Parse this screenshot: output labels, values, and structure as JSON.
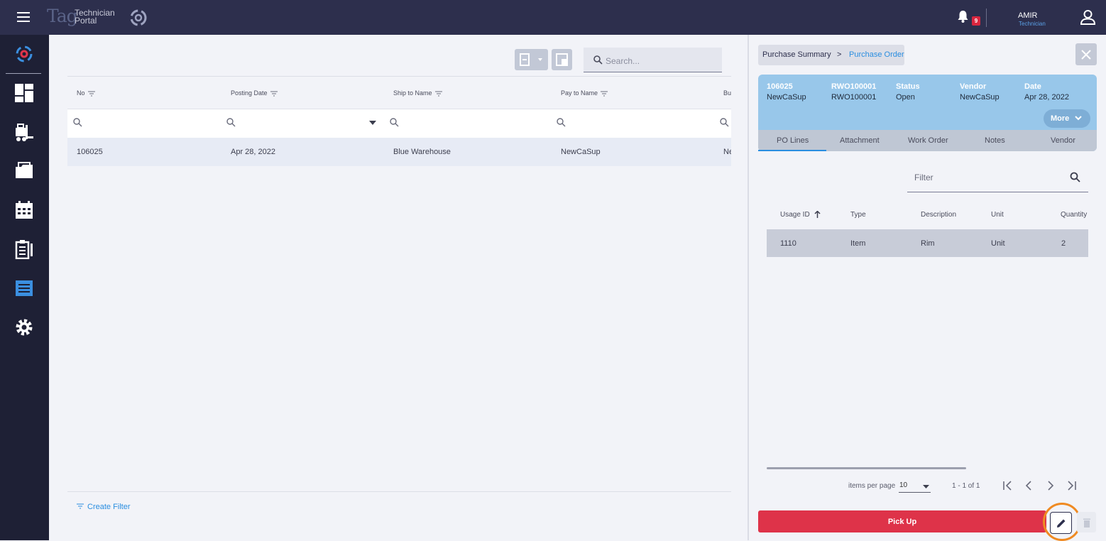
{
  "topbar": {
    "logo_tag": "Tag",
    "logo_line1": "Technician",
    "logo_line2": "Portal",
    "notification_count": "9",
    "user_name": "AMIR",
    "user_role": "Technician"
  },
  "sidebar": {
    "items": [
      {
        "icon": "spinner-logo-icon"
      },
      {
        "icon": "dashboard-icon"
      },
      {
        "icon": "forklift-icon"
      },
      {
        "icon": "folder-icon"
      },
      {
        "icon": "calendar-icon"
      },
      {
        "icon": "checklist-icon"
      },
      {
        "icon": "notebook-icon"
      },
      {
        "icon": "gear-icon"
      }
    ]
  },
  "main": {
    "search_placeholder": "Search...",
    "columns": [
      "No",
      "Posting Date",
      "Ship to Name",
      "Pay to Name",
      "Bu"
    ],
    "rows": [
      {
        "no": "106025",
        "posting_date": "Apr 28, 2022",
        "ship_to": "Blue Warehouse",
        "pay_to": "NewCaSup",
        "bu": "Ne"
      }
    ],
    "create_filter": "Create Filter"
  },
  "panel": {
    "breadcrumb": {
      "parent": "Purchase Summary",
      "separator": ">",
      "current": "Purchase Order"
    },
    "header": {
      "fields": [
        {
          "title": "106025",
          "value": "NewCaSup"
        },
        {
          "title": "RWO100001",
          "value": "RWO100001"
        },
        {
          "title": "Status",
          "value": "Open"
        },
        {
          "title": "Vendor",
          "value": "NewCaSup"
        },
        {
          "title": "Date",
          "value": "Apr 28, 2022"
        }
      ],
      "more_label": "More"
    },
    "tabs": [
      "PO Lines",
      "Attachment",
      "Work Order",
      "Notes",
      "Vendor"
    ],
    "active_tab": "PO Lines",
    "filter_placeholder": "Filter",
    "line_columns": [
      "Usage ID",
      "Type",
      "Description",
      "Unit",
      "Quantity"
    ],
    "lines": [
      {
        "usage_id": "1110",
        "type": "Item",
        "description": "Rim",
        "unit": "Unit",
        "quantity": "2"
      }
    ],
    "pagination": {
      "items_per_page_label": "items per page",
      "items_per_page": "10",
      "range": "1 - 1 of 1"
    },
    "pickup_label": "Pick Up"
  },
  "colors": {
    "topbar": "#2d2f4d",
    "sidebar": "#1e2035",
    "accent": "#2a8ee0",
    "pickup": "#de3349",
    "header_card": "#98c7ea",
    "highlight_ring": "#ef8a22"
  }
}
